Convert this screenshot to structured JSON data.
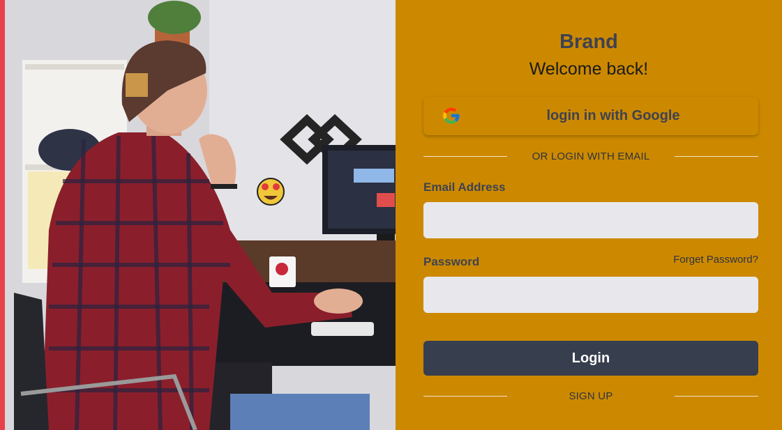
{
  "header": {
    "brand": "Brand",
    "welcome": "Welcome back!"
  },
  "google": {
    "label": "login in with Google",
    "icon": "google-icon"
  },
  "divider_email": {
    "text": "OR LOGIN WITH EMAIL"
  },
  "form": {
    "email_label": "Email Address",
    "email_value": "",
    "password_label": "Password",
    "password_value": "",
    "forgot_label": "Forget Password?",
    "login_label": "Login"
  },
  "divider_signup": {
    "text": "SIGN UP"
  },
  "colors": {
    "panel": "#cc8900",
    "text_dark": "#3f4250",
    "input_bg": "#e8e8ec",
    "login_button": "#373e4d",
    "accent_bar": "#e7424a"
  }
}
